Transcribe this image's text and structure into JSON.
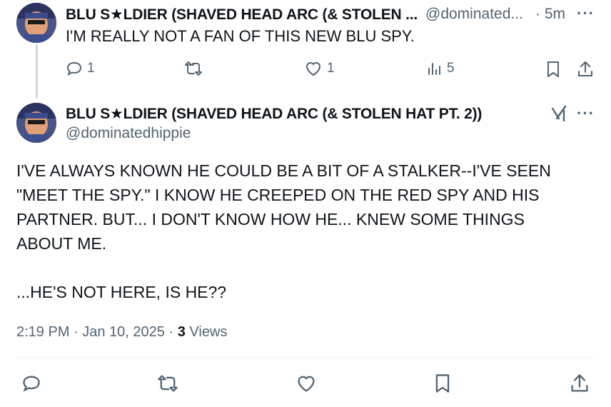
{
  "reply": {
    "display_name": "BLU S★LDIER (SHAVED HEAD ARC (& STOLEN ...",
    "handle": "@dominated...",
    "time": "· 5m",
    "text": "I'M REALLY NOT A FAN OF THIS NEW BLU SPY.",
    "actions": {
      "reply_count": "1",
      "retweet_count": "",
      "like_count": "1",
      "views_count": "5"
    }
  },
  "main": {
    "display_name": "BLU S★LDIER (SHAVED HEAD ARC (& STOLEN HAT PT. 2))",
    "handle": "@dominatedhippie",
    "text": "I'VE ALWAYS KNOWN HE COULD BE A BIT OF A STALKER--I'VE SEEN\n\"MEET THE SPY.\" I KNOW HE CREEPED ON THE RED SPY AND HIS\nPARTNER. BUT... I DON'T KNOW HOW HE... KNEW SOME THINGS\nABOUT ME.\n\n...HE'S NOT HERE, IS HE??",
    "timestamp": "2:19 PM · Jan 10, 2025 ·",
    "views_count": "3",
    "views_label": "Views"
  },
  "icons": [
    "reply-icon",
    "retweet-icon",
    "like-icon",
    "views-icon",
    "bookmark-icon",
    "share-icon",
    "grok-icon",
    "more-icon"
  ],
  "colors": {
    "text": "#0f1419",
    "secondary": "#536471",
    "divider": "#eff3f4"
  }
}
